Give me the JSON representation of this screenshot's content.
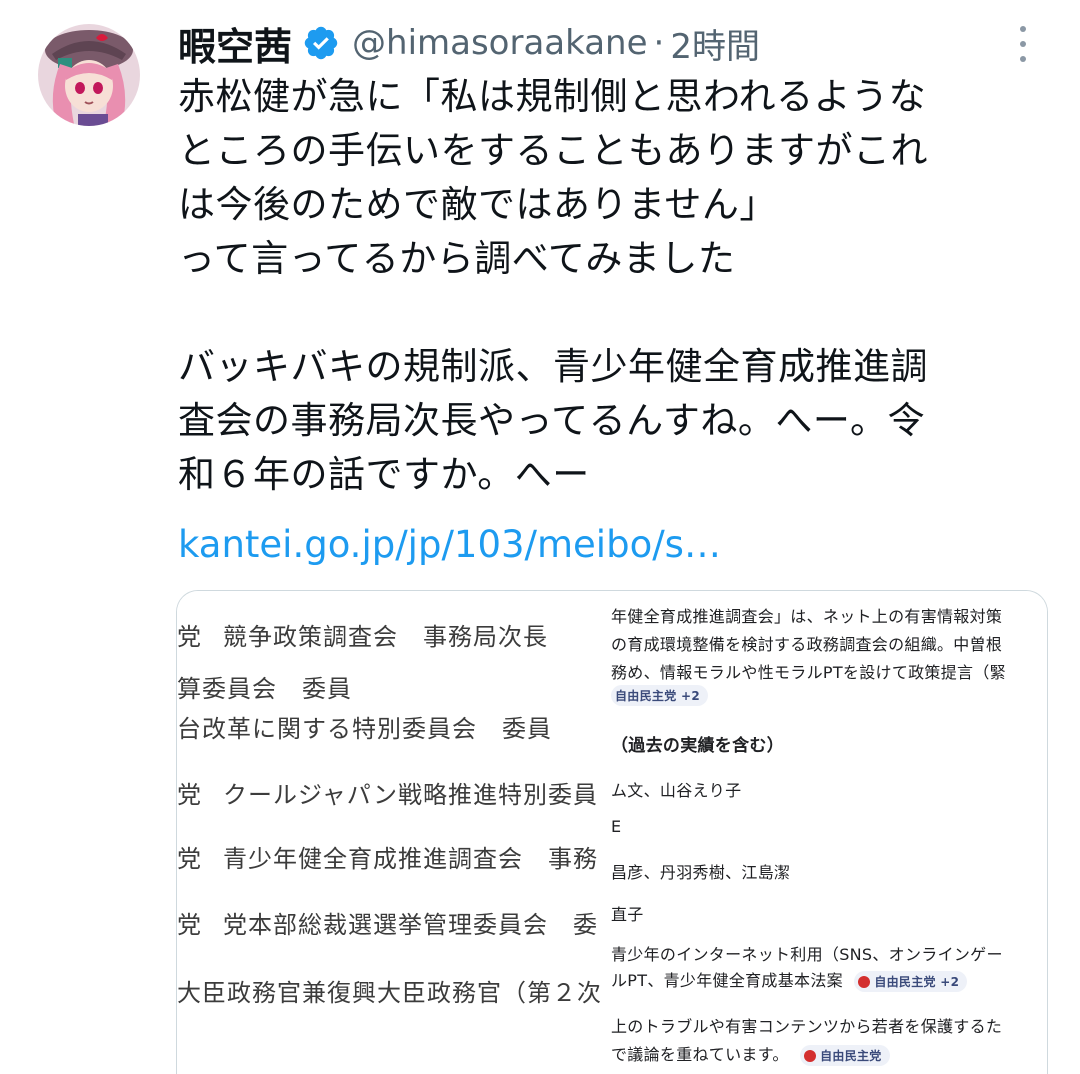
{
  "tweet": {
    "display_name": "暇空茜",
    "handle": "@himasoraakane",
    "separator": "·",
    "time": "2時間",
    "text_lines": [
      "赤松健が急に「私は規制側と思われるような",
      "ところの手伝いをすることもありますがこれ",
      "は今後のためで敵ではありません」",
      "って言ってるから調べてみました",
      "",
      "バッキバキの規制派、青少年健全育成推進調",
      "査会の事務局次長やってるんすね。へー。令",
      "和６年の話ですか。へー"
    ],
    "link": "kantei.go.jp/jp/103/meibo/s…"
  },
  "media_left": {
    "lines": [
      [
        "党",
        "競争政策調査会　事務局次長"
      ],
      [
        "",
        "算委員会　委員"
      ],
      [
        "",
        "台改革に関する特別委員会　委員"
      ],
      [
        "党",
        "クールジャパン戦略推進特別委員"
      ],
      [
        "党",
        "青少年健全育成推進調査会　事務"
      ],
      [
        "党",
        "党本部総裁選選挙管理委員会　委"
      ],
      [
        "",
        "大臣政務官兼復興大臣政務官（第２次"
      ]
    ]
  },
  "media_right": {
    "lines": [
      "年健全育成推進調査会」は、ネット上の有害情報対策",
      "の育成環境整備を検討する政務調査会の組織。中曽根",
      "務め、情報モラルや性モラルPTを設けて政策提言（緊",
      "",
      "（過去の実績を含む）",
      "ム文、山谷えり子",
      "E",
      "昌彦、丹羽秀樹、江島潔",
      "直子",
      "青少年のインターネット利用（SNS、オンラインゲー",
      "ルPT、青少年健全育成基本法案",
      "上のトラブルや有害コンテンツから若者を保護するた",
      "で議論を重ねています。"
    ],
    "chips": [
      "自由民主党 +2",
      "自由民主党 +2",
      "自由民主党"
    ]
  },
  "colors": {
    "link": "#1d9bf0",
    "verified": "#1d9bf0",
    "secondary_text": "#536471"
  },
  "icons": [
    "verified-badge-icon",
    "more-options-icon"
  ]
}
